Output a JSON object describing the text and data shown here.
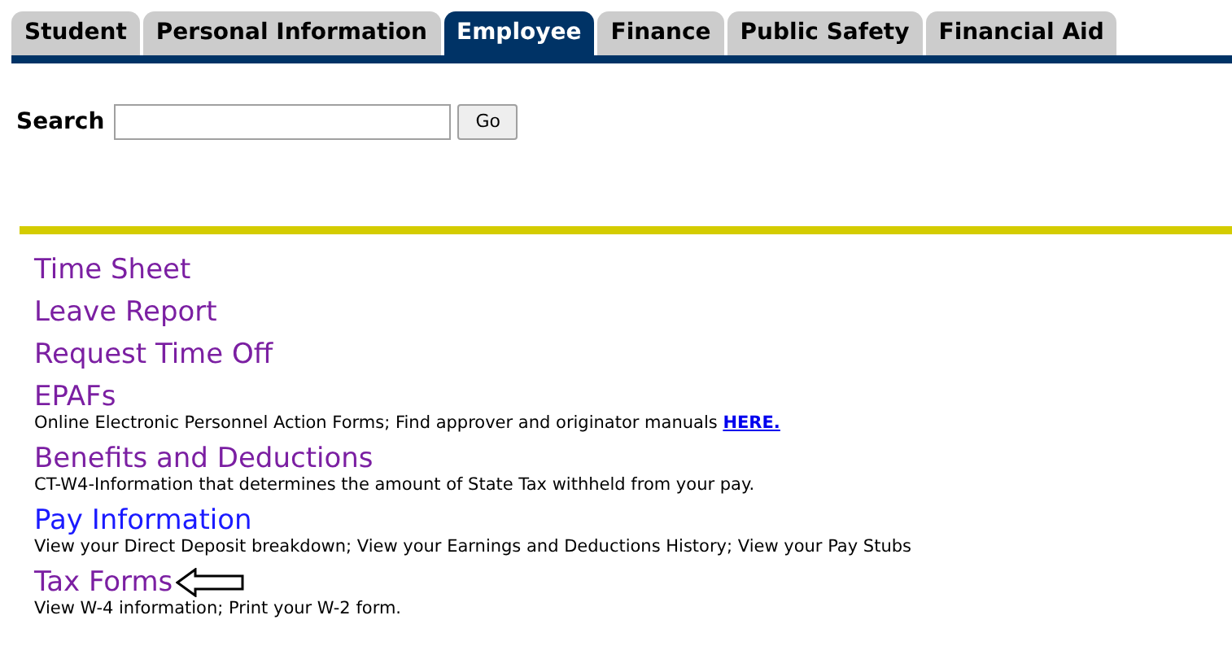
{
  "tabs": [
    {
      "label": "Student",
      "selected": false
    },
    {
      "label": "Personal Information",
      "selected": false
    },
    {
      "label": "Employee",
      "selected": true
    },
    {
      "label": "Finance",
      "selected": false
    },
    {
      "label": "Public Safety",
      "selected": false
    },
    {
      "label": "Financial Aid",
      "selected": false
    }
  ],
  "search": {
    "label": "Search",
    "button": "Go"
  },
  "menu": [
    {
      "title": "Time Sheet",
      "visited": true
    },
    {
      "title": "Leave Report",
      "visited": true
    },
    {
      "title": "Request Time Off",
      "visited": true
    },
    {
      "title": "EPAFs",
      "visited": true,
      "description": "Online Electronic Personnel Action Forms; Find approver and originator manuals ",
      "link": "HERE."
    },
    {
      "title": "Benefits and Deductions",
      "visited": true,
      "description": "CT-W4-Information that determines the amount of State Tax withheld from your pay."
    },
    {
      "title": "Pay Information",
      "visited": false,
      "description": "View your Direct Deposit breakdown; View your Earnings and Deductions History; View your Pay Stubs"
    },
    {
      "title": "Tax Forms",
      "visited": true,
      "pointer": true,
      "description": "View W-4 information; Print your W-2 form."
    }
  ]
}
